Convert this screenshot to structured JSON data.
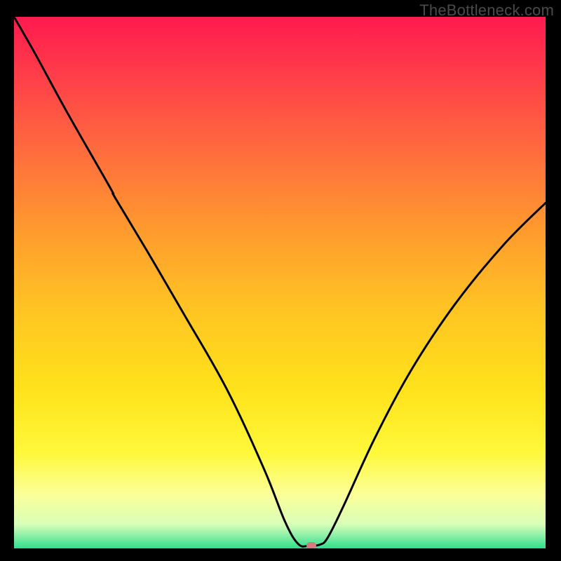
{
  "watermark": "TheBottleneck.com",
  "chart_data": {
    "type": "line",
    "title": "",
    "xlabel": "",
    "ylabel": "",
    "xlim": [
      0,
      100
    ],
    "ylim": [
      0,
      100
    ],
    "legend": false,
    "grid": false,
    "background_gradient": {
      "stops": [
        {
          "pos": 0.0,
          "color": "#ff1a4f"
        },
        {
          "pos": 0.1,
          "color": "#ff3a4a"
        },
        {
          "pos": 0.25,
          "color": "#ff6b3e"
        },
        {
          "pos": 0.4,
          "color": "#ff9a2e"
        },
        {
          "pos": 0.55,
          "color": "#ffc423"
        },
        {
          "pos": 0.7,
          "color": "#ffe21b"
        },
        {
          "pos": 0.82,
          "color": "#fff83a"
        },
        {
          "pos": 0.9,
          "color": "#fbff9a"
        },
        {
          "pos": 0.955,
          "color": "#d8ffb8"
        },
        {
          "pos": 0.975,
          "color": "#8ef0a8"
        },
        {
          "pos": 1.0,
          "color": "#2fe08c"
        }
      ]
    },
    "series": [
      {
        "name": "bottleneck-curve",
        "x": [
          0,
          4,
          10,
          18,
          19,
          25,
          32,
          40,
          47,
          51,
          53.5,
          55.5,
          57.5,
          59,
          62,
          68,
          75,
          83,
          92,
          100
        ],
        "y": [
          100,
          93,
          82,
          68,
          66,
          56,
          44,
          30,
          15,
          5,
          0.8,
          0.5,
          0.7,
          2,
          8,
          21,
          34,
          46,
          57,
          65
        ]
      }
    ],
    "marker": {
      "x": 56,
      "y": 0.5,
      "color": "#d77a7e"
    }
  }
}
